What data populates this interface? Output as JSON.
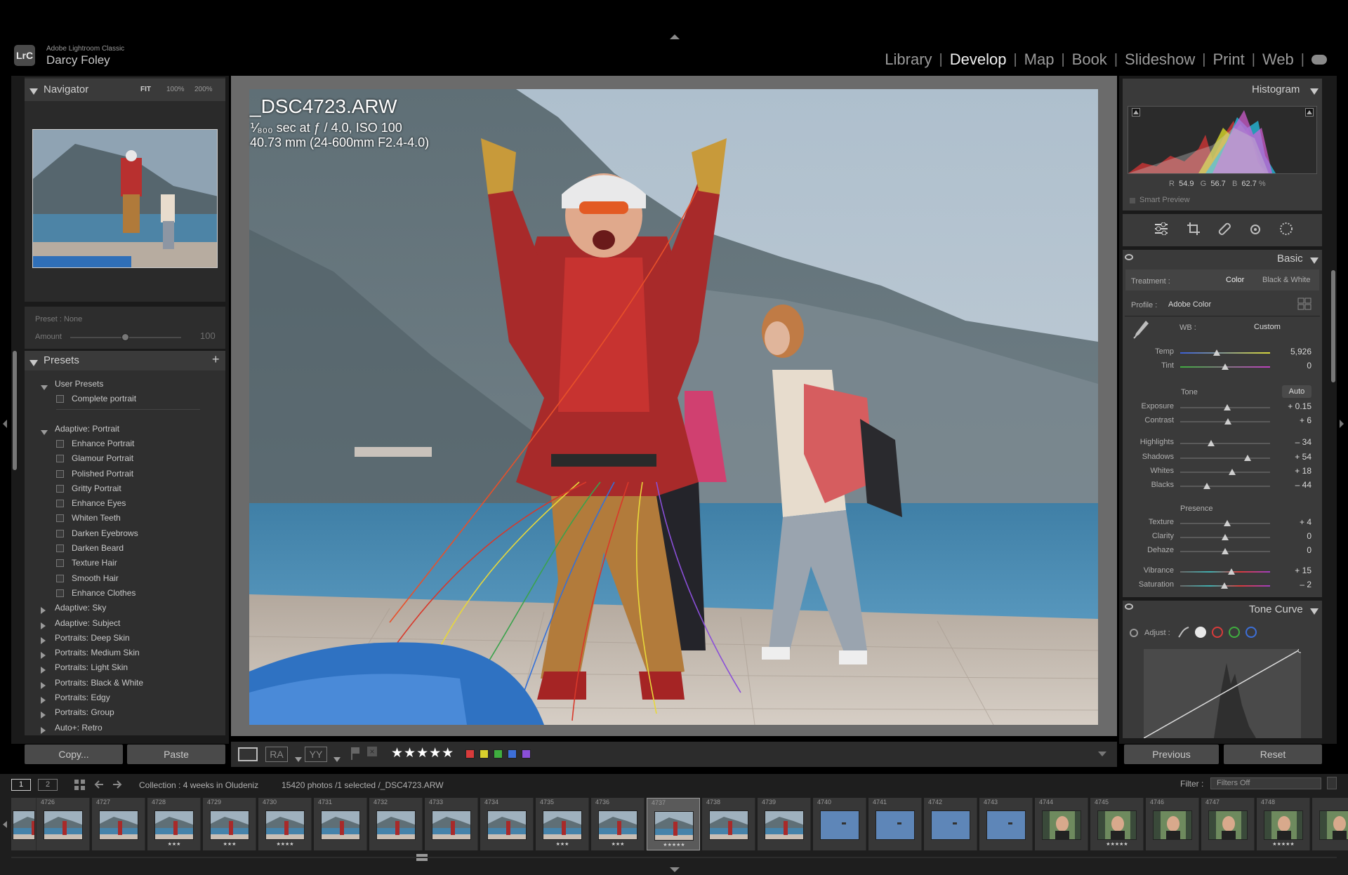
{
  "app": {
    "name": "Adobe Lightroom Classic",
    "logo": "LrC",
    "user": "Darcy Foley"
  },
  "modules": [
    "Library",
    "Develop",
    "Map",
    "Book",
    "Slideshow",
    "Print",
    "Web"
  ],
  "active_module": "Develop",
  "navigator": {
    "title": "Navigator",
    "zoom_fit": "FIT",
    "zoom_100": "100%",
    "zoom_200": "200%"
  },
  "preset_amount": {
    "preset_label": "Preset : None",
    "amount_label": "Amount",
    "amount_value": "100"
  },
  "presets": {
    "title": "Presets",
    "add": "+",
    "groups": [
      {
        "name": "User Presets",
        "open": true,
        "items": [
          "Complete portrait"
        ]
      },
      {
        "name": "Adaptive: Portrait",
        "open": true,
        "items": [
          "Enhance Portrait",
          "Glamour Portrait",
          "Polished Portrait",
          "Gritty Portrait",
          "Enhance Eyes",
          "Whiten Teeth",
          "Darken Eyebrows",
          "Darken Beard",
          "Texture Hair",
          "Smooth Hair",
          "Enhance Clothes"
        ]
      },
      {
        "name": "Adaptive: Sky",
        "open": false,
        "items": []
      },
      {
        "name": "Adaptive: Subject",
        "open": false,
        "items": []
      },
      {
        "name": "Portraits: Deep Skin",
        "open": false,
        "items": []
      },
      {
        "name": "Portraits: Medium Skin",
        "open": false,
        "items": []
      },
      {
        "name": "Portraits: Light Skin",
        "open": false,
        "items": []
      },
      {
        "name": "Portraits: Black & White",
        "open": false,
        "items": []
      },
      {
        "name": "Portraits: Edgy",
        "open": false,
        "items": []
      },
      {
        "name": "Portraits: Group",
        "open": false,
        "items": []
      },
      {
        "name": "Auto+: Retro",
        "open": false,
        "items": []
      }
    ]
  },
  "left_buttons": {
    "copy": "Copy...",
    "paste": "Paste"
  },
  "photo_info": {
    "filename": "_DSC4723.ARW",
    "exposure": "⅟₈₀₀ sec at ƒ / 4.0, ISO 100",
    "lens": "40.73 mm (24-600mm F2.4-4.0)"
  },
  "toolbar": {
    "stars": "★★★★★",
    "labels": [
      "#d83b3b",
      "#d8cf2d",
      "#3fae3f",
      "#3d6fd8",
      "#8a4fd8"
    ],
    "view_ra": "RA",
    "view_yy": "YY"
  },
  "histogram": {
    "title": "Histogram",
    "r_label": "R",
    "r": "54.9",
    "g_label": "G",
    "g": "56.7",
    "b_label": "B",
    "b": "62.7",
    "pct": "%",
    "smart_preview": "Smart Preview"
  },
  "basic": {
    "title": "Basic",
    "treatment_label": "Treatment :",
    "treatment_color": "Color",
    "treatment_bw": "Black & White",
    "profile_label": "Profile :",
    "profile_value": "Adobe Color",
    "wb_label": "WB :",
    "wb_value": "Custom",
    "temp": {
      "label": "Temp",
      "value": "5,926",
      "pos": 0.41
    },
    "tint": {
      "label": "Tint",
      "value": "0",
      "pos": 0.5
    },
    "tone_label": "Tone",
    "auto": "Auto",
    "exposure": {
      "label": "Exposure",
      "value": "+ 0.15",
      "pos": 0.52
    },
    "contrast": {
      "label": "Contrast",
      "value": "+ 6",
      "pos": 0.53
    },
    "highlights": {
      "label": "Highlights",
      "value": "– 34",
      "pos": 0.34
    },
    "shadows": {
      "label": "Shadows",
      "value": "+ 54",
      "pos": 0.75
    },
    "whites": {
      "label": "Whites",
      "value": "+ 18",
      "pos": 0.58
    },
    "blacks": {
      "label": "Blacks",
      "value": "– 44",
      "pos": 0.3
    },
    "presence_label": "Presence",
    "texture": {
      "label": "Texture",
      "value": "+ 4",
      "pos": 0.52
    },
    "clarity": {
      "label": "Clarity",
      "value": "0",
      "pos": 0.5
    },
    "dehaze": {
      "label": "Dehaze",
      "value": "0",
      "pos": 0.5
    },
    "vibrance": {
      "label": "Vibrance",
      "value": "+ 15",
      "pos": 0.57
    },
    "saturation": {
      "label": "Saturation",
      "value": "– 2",
      "pos": 0.49
    }
  },
  "tone_curve": {
    "title": "Tone Curve",
    "adjust_label": "Adjust :"
  },
  "right_buttons": {
    "previous": "Previous",
    "reset": "Reset"
  },
  "filmstrip_bar": {
    "page1": "1",
    "page2": "2",
    "collection": "Collection : 4 weeks in Oludeniz",
    "count": "15420 photos /1 selected /_DSC4723.ARW",
    "filter_label": "Filter :",
    "filter_value": "Filters Off"
  },
  "filmstrip": [
    {
      "num": "",
      "kind": "sea",
      "stars": ""
    },
    {
      "num": "4726",
      "kind": "sea",
      "stars": ""
    },
    {
      "num": "4727",
      "kind": "sea",
      "stars": ""
    },
    {
      "num": "4728",
      "kind": "sea",
      "stars": "★★★"
    },
    {
      "num": "4729",
      "kind": "sea",
      "stars": "★★★"
    },
    {
      "num": "4730",
      "kind": "sea",
      "stars": "★★★★"
    },
    {
      "num": "4731",
      "kind": "sea",
      "stars": ""
    },
    {
      "num": "4732",
      "kind": "sea",
      "stars": ""
    },
    {
      "num": "4733",
      "kind": "sea",
      "stars": ""
    },
    {
      "num": "4734",
      "kind": "sea",
      "stars": ""
    },
    {
      "num": "4735",
      "kind": "sea",
      "stars": "★★★"
    },
    {
      "num": "4736",
      "kind": "sea",
      "stars": "★★★"
    },
    {
      "num": "4737",
      "kind": "sea",
      "stars": "★★★★★",
      "selected": true
    },
    {
      "num": "4738",
      "kind": "sea",
      "stars": ""
    },
    {
      "num": "4739",
      "kind": "sea",
      "stars": ""
    },
    {
      "num": "4740",
      "kind": "sky",
      "stars": ""
    },
    {
      "num": "4741",
      "kind": "sky",
      "stars": ""
    },
    {
      "num": "4742",
      "kind": "sky",
      "stars": ""
    },
    {
      "num": "4743",
      "kind": "sky",
      "stars": ""
    },
    {
      "num": "4744",
      "kind": "portrait",
      "stars": ""
    },
    {
      "num": "4745",
      "kind": "portrait",
      "stars": "★★★★★"
    },
    {
      "num": "4746",
      "kind": "portrait",
      "stars": ""
    },
    {
      "num": "4747",
      "kind": "portrait",
      "stars": ""
    },
    {
      "num": "4748",
      "kind": "portrait",
      "stars": "★★★★★"
    },
    {
      "num": "",
      "kind": "portrait",
      "stars": ""
    }
  ]
}
